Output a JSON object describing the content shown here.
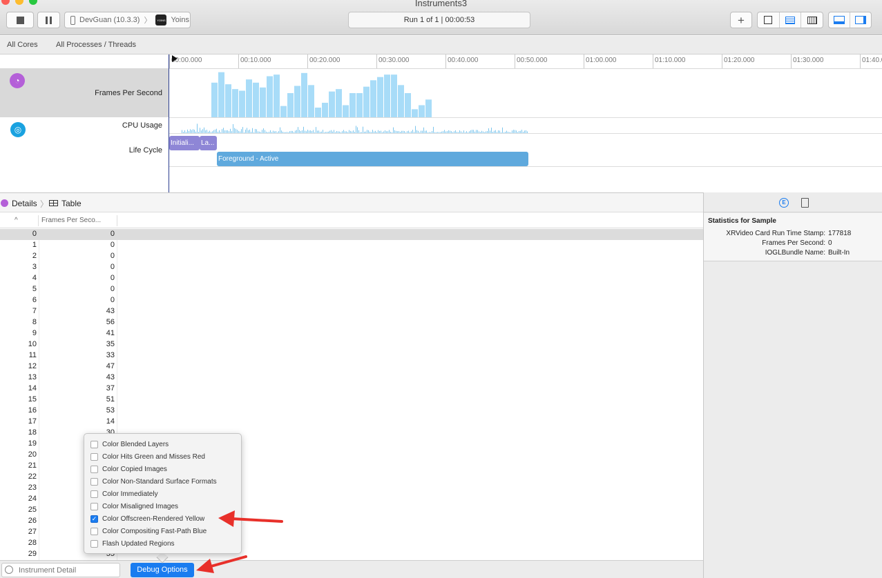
{
  "window": {
    "title": "Instruments3"
  },
  "toolbar": {
    "device": "DevGuan (10.3.3)",
    "app": "Yoins",
    "app_icon_text": "YOINS",
    "run_status": "Run 1 of 1",
    "run_time": "00:00:53"
  },
  "filterbar": {
    "all_cores": "All Cores",
    "all_processes": "All Processes / Threads"
  },
  "timeline": {
    "ticks": [
      "00:00.000",
      "00:10.000",
      "00:20.000",
      "00:30.000",
      "00:40.000",
      "00:50.000",
      "01:00.000",
      "01:10.000",
      "01:20.000",
      "01:30.000",
      "01:40.0"
    ]
  },
  "tracks": {
    "fps_label": "Frames Per Second",
    "cpu_label": "CPU Usage",
    "lifecycle_label": "Life Cycle",
    "lifecycle_segments": [
      "Initiali...",
      "La...",
      "Foreground - Active"
    ]
  },
  "fps_graph": [
    43,
    56,
    41,
    35,
    33,
    47,
    43,
    37,
    51,
    53,
    14,
    30,
    39,
    55,
    40,
    12,
    18,
    32,
    35,
    15,
    30,
    30,
    38,
    46,
    50,
    53,
    53,
    40,
    30,
    10,
    15,
    22
  ],
  "details": {
    "details_label": "Details",
    "table_label": "Table"
  },
  "table": {
    "col_index_header": "^",
    "col_fps_header": "Frames Per Seco...",
    "rows": [
      [
        "0",
        "0"
      ],
      [
        "1",
        "0"
      ],
      [
        "2",
        "0"
      ],
      [
        "3",
        "0"
      ],
      [
        "4",
        "0"
      ],
      [
        "5",
        "0"
      ],
      [
        "6",
        "0"
      ],
      [
        "7",
        "43"
      ],
      [
        "8",
        "56"
      ],
      [
        "9",
        "41"
      ],
      [
        "10",
        "35"
      ],
      [
        "11",
        "33"
      ],
      [
        "12",
        "47"
      ],
      [
        "13",
        "43"
      ],
      [
        "14",
        "37"
      ],
      [
        "15",
        "51"
      ],
      [
        "16",
        "53"
      ],
      [
        "17",
        "14"
      ],
      [
        "18",
        "30"
      ],
      [
        "19",
        ""
      ],
      [
        "20",
        ""
      ],
      [
        "21",
        ""
      ],
      [
        "22",
        ""
      ],
      [
        "23",
        ""
      ],
      [
        "24",
        ""
      ],
      [
        "25",
        ""
      ],
      [
        "26",
        ""
      ],
      [
        "27",
        ""
      ],
      [
        "28",
        ""
      ],
      [
        "29",
        "55"
      ]
    ]
  },
  "inspector": {
    "title": "Statistics for Sample",
    "fields": [
      {
        "key": "XRVideo Card Run Time Stamp:",
        "value": "177818"
      },
      {
        "key": "Frames Per Second:",
        "value": "0"
      },
      {
        "key": "IOGLBundle Name:",
        "value": "Built-In"
      }
    ]
  },
  "bottombar": {
    "filter_placeholder": "Instrument Detail",
    "debug_button": "Debug Options"
  },
  "debug_menu": {
    "options": [
      {
        "label": "Color Blended Layers",
        "checked": false
      },
      {
        "label": "Color Hits Green and Misses Red",
        "checked": false
      },
      {
        "label": "Color Copied Images",
        "checked": false
      },
      {
        "label": "Color Non-Standard Surface Formats",
        "checked": false
      },
      {
        "label": "Color Immediately",
        "checked": false
      },
      {
        "label": "Color Misaligned Images",
        "checked": false
      },
      {
        "label": "Color Offscreen-Rendered Yellow",
        "checked": true
      },
      {
        "label": "Color Compositing Fast-Path Blue",
        "checked": false
      },
      {
        "label": "Flash Updated Regions",
        "checked": false
      }
    ]
  },
  "colors": {
    "accent": "#1a7cf0",
    "fps_bar": "#a8dcf8",
    "lifecycle_purple": "#8e86d6",
    "lifecycle_blue": "#5fa9dd",
    "arrow": "#e8302a"
  }
}
